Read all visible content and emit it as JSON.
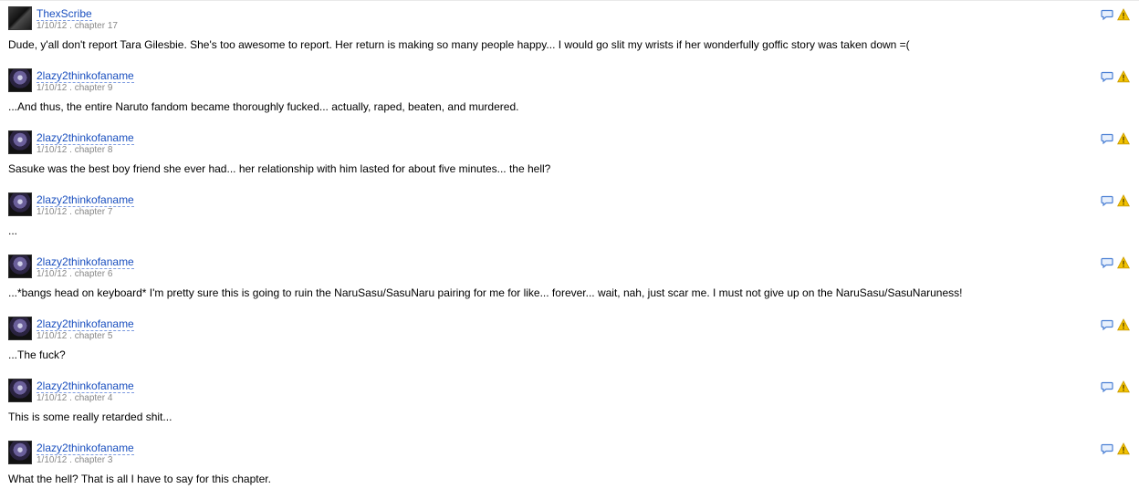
{
  "reviews": [
    {
      "author": "ThexScribe",
      "meta": "1/10/12 . chapter 17",
      "text": "Dude, y'all don't report Tara Gilesbie. She's too awesome to report. Her return is making so many people happy... I would go slit my wrists if her wonderfully goffic story was taken down =(",
      "avatar": "scribe"
    },
    {
      "author": "2lazy2thinkofaname",
      "meta": "1/10/12 . chapter 9",
      "text": "...And thus, the entire Naruto fandom became thoroughly fucked... actually, raped, beaten, and murdered.",
      "avatar": "lazy"
    },
    {
      "author": "2lazy2thinkofaname",
      "meta": "1/10/12 . chapter 8",
      "text": "Sasuke was the best boy friend she ever had... her relationship with him lasted for about five minutes... the hell?",
      "avatar": "lazy"
    },
    {
      "author": "2lazy2thinkofaname",
      "meta": "1/10/12 . chapter 7",
      "text": "...",
      "avatar": "lazy"
    },
    {
      "author": "2lazy2thinkofaname",
      "meta": "1/10/12 . chapter 6",
      "text": "...*bangs head on keyboard* I'm pretty sure this is going to ruin the NaruSasu/SasuNaru pairing for me for like... forever... wait, nah, just scar me. I must not give up on the NaruSasu/SasuNaruness!",
      "avatar": "lazy"
    },
    {
      "author": "2lazy2thinkofaname",
      "meta": "1/10/12 . chapter 5",
      "text": "...The fuck?",
      "avatar": "lazy"
    },
    {
      "author": "2lazy2thinkofaname",
      "meta": "1/10/12 . chapter 4",
      "text": "This is some really retarded shit...",
      "avatar": "lazy"
    },
    {
      "author": "2lazy2thinkofaname",
      "meta": "1/10/12 . chapter 3",
      "text": "What the hell? That is all I have to say for this chapter.",
      "avatar": "lazy"
    }
  ],
  "icons": {
    "reply": "speech-bubble-icon",
    "report": "warning-triangle-icon"
  },
  "colors": {
    "link": "#1a4fbf",
    "meta": "#888888",
    "reply_icon": "#4a7fd4",
    "warning_icon": "#f2c200"
  }
}
